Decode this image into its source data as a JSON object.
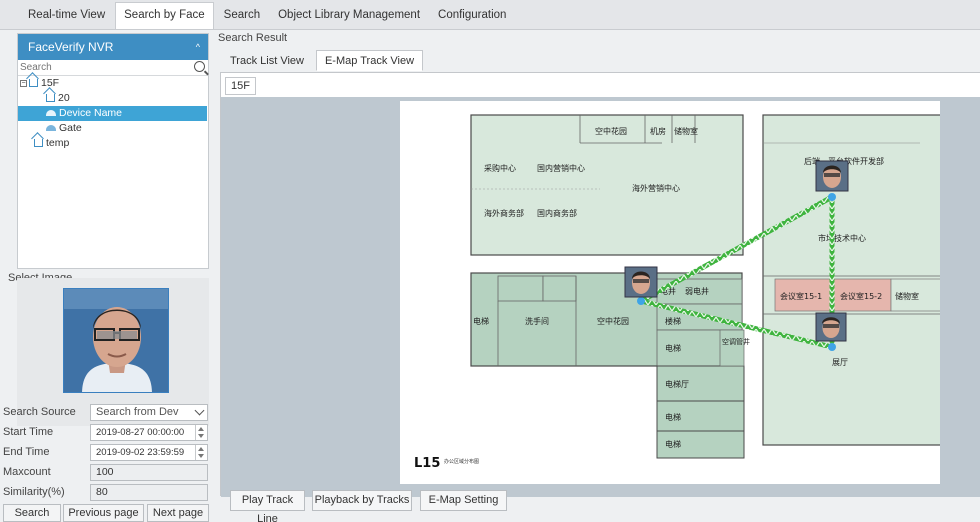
{
  "top_tabs": [
    "Real-time View",
    "Search by Face",
    "Search",
    "Object Library Management",
    "Configuration"
  ],
  "active_top_tab": 1,
  "tree": {
    "title": "FaceVerify NVR",
    "search_placeholder": "Search",
    "nodes": [
      {
        "label": "15F",
        "type": "area",
        "level": 0,
        "expanded": true
      },
      {
        "label": "20",
        "type": "area",
        "level": 1
      },
      {
        "label": "Device Name",
        "type": "camera",
        "level": 1,
        "selected": true
      },
      {
        "label": "Gate",
        "type": "camera",
        "level": 1
      },
      {
        "label": "temp",
        "type": "area",
        "level": 0
      }
    ]
  },
  "select_image": {
    "label": "Select Image"
  },
  "form": {
    "search_source_label": "Search Source",
    "search_source_value": "Search from Dev",
    "start_time_label": "Start Time",
    "start_time_value": "2019-08-27 00:00:00",
    "end_time_label": "End Time",
    "end_time_value": "2019-09-02 23:59:59",
    "maxcount_label": "Maxcount",
    "maxcount_value": "100",
    "similarity_label": "Similarity(%)",
    "similarity_value": "80"
  },
  "buttons": {
    "search": "Search",
    "previous": "Previous page",
    "next": "Next page"
  },
  "result": {
    "title": "Search Result",
    "tabs": [
      "Track List View",
      "E-Map Track View"
    ],
    "active_tab": 1,
    "floor_tab": "15F"
  },
  "map": {
    "floor_label": "L15",
    "floor_caption": "办公区域分布图",
    "rooms": [
      "空中花园",
      "机房",
      "储物室",
      "采购中心",
      "国内营销中心",
      "海外营销中心",
      "海外商务部",
      "国内商务部",
      "后端、平台软件开发部",
      "市场技术中心",
      "会议室15-1",
      "会议室15-2",
      "储物室",
      "展厅",
      "电梯",
      "洗手间",
      "空中花园",
      "楼梯",
      "电井",
      "弱电井",
      "电梯",
      "空调管井",
      "电梯厅",
      "电梯",
      "电梯"
    ]
  },
  "bottom_buttons": [
    "Play Track Line",
    "Playback by Tracks",
    "E-Map Setting"
  ],
  "colors": {
    "accent": "#3e8ec3",
    "selection": "#3ea4d6",
    "track": "#2fa52f",
    "room": "#d8e8dc",
    "room_dark": "#b5d2c0",
    "meeting": "#e5b6ad"
  }
}
